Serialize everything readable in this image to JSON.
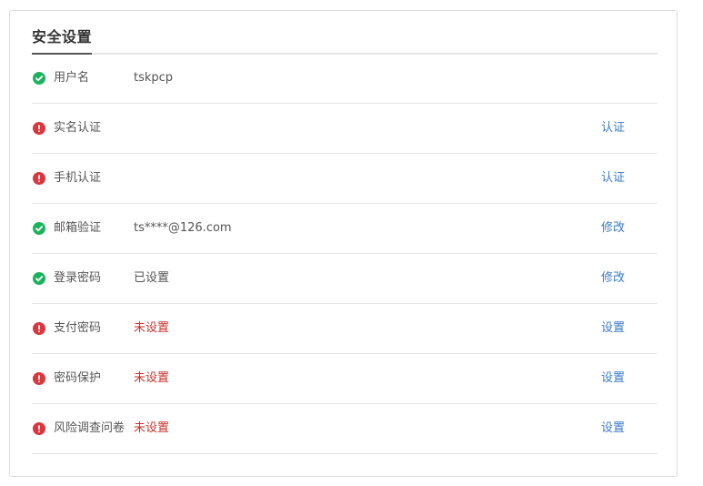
{
  "title": "安全设置",
  "colors": {
    "ok": "#1db35c",
    "warn": "#d9363e",
    "link": "#3a7bc8",
    "unset_text": "#c9302c"
  },
  "rows": [
    {
      "status": "ok",
      "status_icon": "check-circle-icon",
      "label": "用户名",
      "value": "tskpcp",
      "value_style": "normal",
      "action": ""
    },
    {
      "status": "warn",
      "status_icon": "exclamation-circle-icon",
      "label": "实名认证",
      "value": "",
      "value_style": "normal",
      "action": "认证"
    },
    {
      "status": "warn",
      "status_icon": "exclamation-circle-icon",
      "label": "手机认证",
      "value": "",
      "value_style": "normal",
      "action": "认证"
    },
    {
      "status": "ok",
      "status_icon": "check-circle-icon",
      "label": "邮箱验证",
      "value": "ts****@126.com",
      "value_style": "normal",
      "action": "修改"
    },
    {
      "status": "ok",
      "status_icon": "check-circle-icon",
      "label": "登录密码",
      "value": "已设置",
      "value_style": "normal",
      "action": "修改"
    },
    {
      "status": "warn",
      "status_icon": "exclamation-circle-icon",
      "label": "支付密码",
      "value": "未设置",
      "value_style": "unset",
      "action": "设置"
    },
    {
      "status": "warn",
      "status_icon": "exclamation-circle-icon",
      "label": "密码保护",
      "value": "未设置",
      "value_style": "unset",
      "action": "设置"
    },
    {
      "status": "warn",
      "status_icon": "exclamation-circle-icon",
      "label": "风险调查问卷",
      "value": "未设置",
      "value_style": "unset",
      "action": "设置"
    }
  ]
}
